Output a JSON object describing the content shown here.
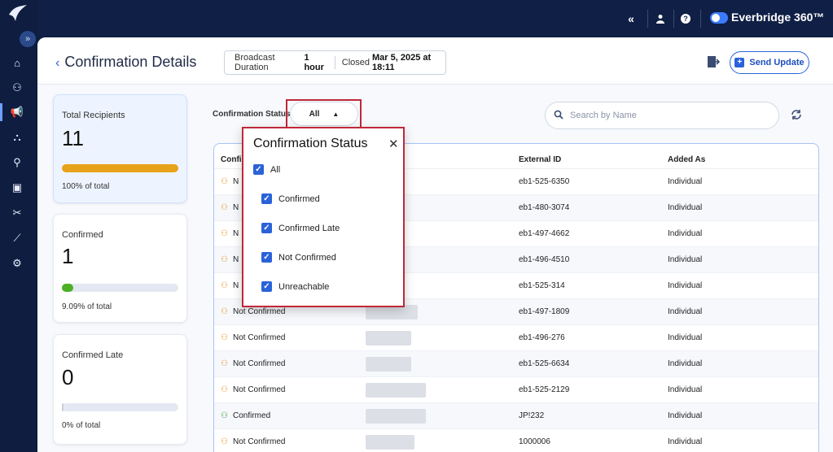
{
  "topbar": {
    "collapse_glyph": "«",
    "brand": "Everbridge 360™"
  },
  "sidebar": {
    "expand_glyph": "»",
    "items": [
      {
        "icon": "home-icon",
        "glyph": "⌂"
      },
      {
        "icon": "contacts-icon",
        "glyph": "⚇"
      },
      {
        "icon": "broadcast-icon",
        "glyph": "📢"
      },
      {
        "icon": "teams-icon",
        "glyph": "⛬"
      },
      {
        "icon": "location-icon",
        "glyph": "⚲"
      },
      {
        "icon": "calendar-icon",
        "glyph": "▣"
      },
      {
        "icon": "tools-icon",
        "glyph": "✂"
      },
      {
        "icon": "reports-icon",
        "glyph": "⟋"
      },
      {
        "icon": "settings-icon",
        "glyph": "⚙"
      }
    ]
  },
  "header": {
    "title": "Confirmation Details",
    "broadcast_label": "Broadcast Duration",
    "broadcast_value": "1 hour",
    "closed_label": "Closed",
    "closed_value": "Mar 5, 2025 at 18:11",
    "send_update": "Send Update"
  },
  "cards": [
    {
      "title": "Total Recipients",
      "value": "11",
      "pct_label": "100% of total",
      "fraction": 1.0,
      "color": "#e8a21a"
    },
    {
      "title": "Confirmed",
      "value": "1",
      "pct_label": "9.09% of total",
      "fraction": 0.0909,
      "color": "#4caf24"
    },
    {
      "title": "Confirmed Late",
      "value": "0",
      "pct_label": "0% of total",
      "fraction": 0.0,
      "color": "#c9ced8"
    }
  ],
  "filter": {
    "label": "Confirmation Status",
    "selected": "All",
    "search_placeholder": "Search by Name"
  },
  "table": {
    "columns": {
      "status": "Confir",
      "external_id": "External ID",
      "added_as": "Added As"
    },
    "rows": [
      {
        "status": "N",
        "external_id": "eb1-525-6350",
        "added_as": "Individual"
      },
      {
        "status": "N",
        "external_id": "eb1-480-3074",
        "added_as": "Individual"
      },
      {
        "status": "N",
        "external_id": "eb1-497-4662",
        "added_as": "Individual"
      },
      {
        "status": "N",
        "external_id": "eb1-496-4510",
        "added_as": "Individual"
      },
      {
        "status": "N",
        "external_id": "eb1-525-314",
        "added_as": "Individual"
      },
      {
        "status": "Not Confirmed",
        "external_id": "eb1-497-1809",
        "added_as": "Individual"
      },
      {
        "status": "Not Confirmed",
        "external_id": "eb1-496-276",
        "added_as": "Individual"
      },
      {
        "status": "Not Confirmed",
        "external_id": "eb1-525-6634",
        "added_as": "Individual"
      },
      {
        "status": "Not Confirmed",
        "external_id": "eb1-525-2129",
        "added_as": "Individual"
      },
      {
        "status": "Confirmed",
        "external_id": "JP!232",
        "added_as": "Individual"
      },
      {
        "status": "Not Confirmed",
        "external_id": "1000006",
        "added_as": "Individual"
      }
    ]
  },
  "popup": {
    "title": "Confirmation Status",
    "close_glyph": "✕",
    "options": [
      {
        "label": "All",
        "checked": true
      },
      {
        "label": "Confirmed",
        "checked": true
      },
      {
        "label": "Confirmed Late",
        "checked": true
      },
      {
        "label": "Not Confirmed",
        "checked": true
      },
      {
        "label": "Unreachable",
        "checked": true
      }
    ]
  }
}
